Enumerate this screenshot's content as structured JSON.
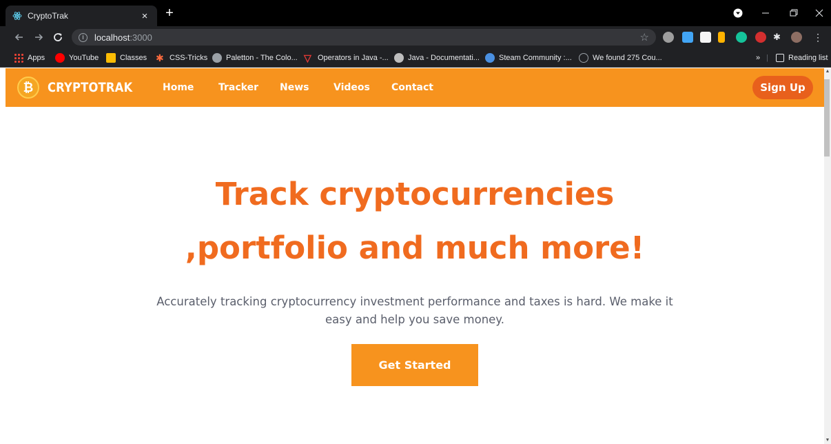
{
  "browser": {
    "tab_title": "CryptoTrak",
    "tab_close": "×",
    "new_tab": "+",
    "url_host": "localhost",
    "url_port": ":3000",
    "bookmarks": [
      {
        "label": "Apps",
        "icon": "apps-grid-icon",
        "color": "#ea4335"
      },
      {
        "label": "YouTube",
        "icon": "youtube-icon",
        "color": "#ff0000"
      },
      {
        "label": "Classes",
        "icon": "classroom-icon",
        "color": "#fbbc04"
      },
      {
        "label": "CSS-Tricks",
        "icon": "css-tricks-icon",
        "color": "#ff6b3d"
      },
      {
        "label": "Paletton - The Colo...",
        "icon": "paletton-icon",
        "color": "#9aa0a6"
      },
      {
        "label": "Operators in Java -...",
        "icon": "javatpoint-icon",
        "color": "#e53935"
      },
      {
        "label": "Java - Documentati...",
        "icon": "java-docs-icon",
        "color": "#bdbdbd"
      },
      {
        "label": "Steam Community :...",
        "icon": "steam-icon",
        "color": "#4a90e2"
      },
      {
        "label": "We found 275 Cou...",
        "icon": "coupon-icon",
        "color": "#9aa0a6"
      }
    ],
    "overflow": "»",
    "reading_list": "Reading list"
  },
  "site": {
    "brand": "CRYPTOTRAK",
    "logo_symbol": "₿",
    "nav": [
      "Home",
      "Tracker",
      "News",
      "Videos",
      "Contact"
    ],
    "signup": "Sign Up",
    "hero_line1": "Track cryptocurrencies",
    "hero_line2": ",portfolio and much more!",
    "hero_sub": "Accurately tracking cryptocurrency investment performance and taxes is hard. We make it easy and help you save money.",
    "cta": "Get Started"
  },
  "colors": {
    "nav_bg": "#f7931e",
    "signup_bg": "#e8601c",
    "headline": "#f06b1f",
    "subtext": "#5a5e6b"
  }
}
